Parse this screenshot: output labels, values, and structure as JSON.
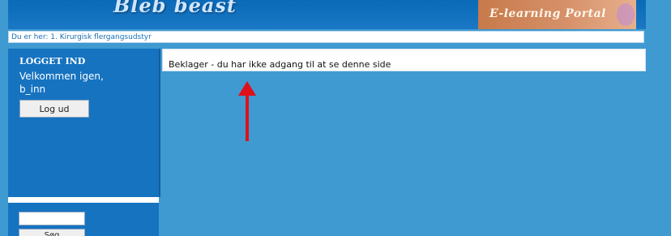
{
  "header": {
    "brand_text": "Bleb beast",
    "portal_text": "E-learning Portal"
  },
  "breadcrumb": {
    "text": "Du er her: 1. Kirurgisk flergangsudstyr"
  },
  "sidebar": {
    "login_heading": "LOGGET IND",
    "welcome": "Velkommen igen,",
    "username": "b_inn",
    "logout_label": "Log ud",
    "search_value": "",
    "search_button_label": "Søg"
  },
  "main": {
    "message": "Beklager - du har ikke adgang til at se denne side"
  },
  "colors": {
    "background": "#3f9ad1",
    "sidebar": "#1673c0",
    "annotation_arrow": "#e0101a"
  },
  "icons": {
    "annotation": "up-arrow-icon"
  }
}
